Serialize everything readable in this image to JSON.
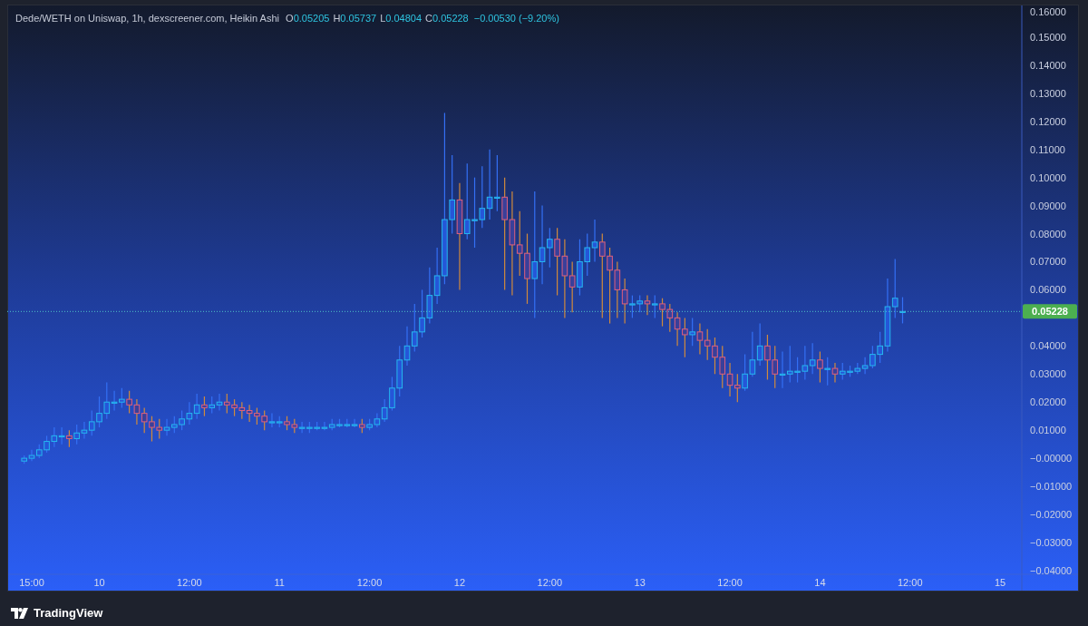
{
  "chart": {
    "legend": {
      "title": "Dede/WETH on Uniswap, 1h, dexscreener.com, Heikin Ashi",
      "values": [
        {
          "label": "O",
          "value": "0.05205"
        },
        {
          "label": "H",
          "value": "0.05737"
        },
        {
          "label": "L",
          "value": "0.04804"
        },
        {
          "label": "C",
          "value": "0.05228"
        }
      ],
      "change": "−0.00530 (−9.20%)"
    },
    "price_label": "0.05228",
    "price_axis_upper": [
      "0.16000",
      "0.15000",
      "0.14000",
      "0.13000",
      "0.12000",
      "0.11000",
      "0.10000",
      "0.09000",
      "0.08000",
      "0.07000",
      "0.06000"
    ],
    "price_axis_lower": [
      "0.04000",
      "0.03000",
      "0.02000",
      "0.01000",
      "−0.00000",
      "−0.01000",
      "−0.02000",
      "−0.03000",
      "−0.04000"
    ],
    "time_axis": [
      "15:00",
      "10",
      "12:00",
      "11",
      "12:00",
      "12",
      "12:00",
      "13",
      "12:00",
      "14",
      "12:00",
      "15"
    ]
  },
  "footer": {
    "brand": "TradingView"
  }
}
